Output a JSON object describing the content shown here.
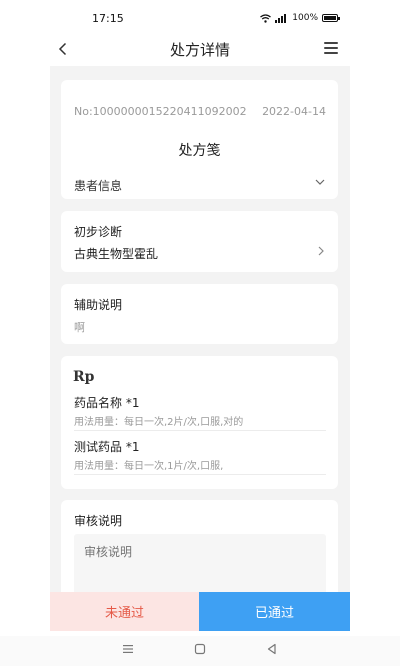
{
  "status_bar": {
    "time": "17:15",
    "battery": "100%",
    "icons": [
      "wifi-icon",
      "signal-icon",
      "battery-icon"
    ]
  },
  "nav": {
    "title": "处方详情",
    "back_icon": "back-chevron-icon",
    "menu_icon": "menu-icon"
  },
  "prescription": {
    "number": "No:1000000015220411092002",
    "date": "2022-04-14",
    "heading": "处方笺",
    "patient_info_label": "患者信息"
  },
  "diagnosis": {
    "label": "初步诊断",
    "value": "古典生物型霍乱"
  },
  "notes": {
    "label": "辅助说明",
    "value": "啊"
  },
  "rp": {
    "mark": "Rp",
    "drugs": [
      {
        "name": "药品名称 *1",
        "usage": "用法用量：每日一次,2片/次,口服,对的"
      },
      {
        "name": "测试药品 *1",
        "usage": "用法用量：每日一次,1片/次,口服,"
      }
    ]
  },
  "review": {
    "label": "审核说明",
    "placeholder": "审核说明"
  },
  "actions": {
    "reject_label": "未通过",
    "approve_label": "已通过"
  },
  "colors": {
    "reject_bg": "#fce5e3",
    "reject_text": "#e55a48",
    "approve_bg": "#3ea0f3",
    "page_bg": "#f3f3f3"
  }
}
